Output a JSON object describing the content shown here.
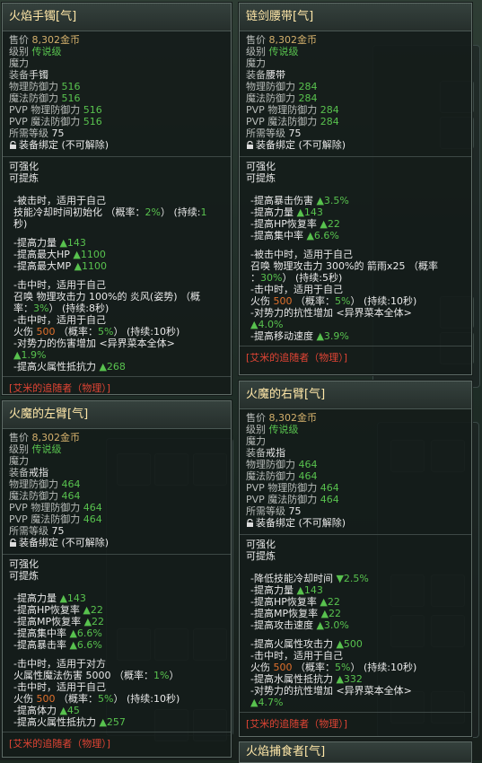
{
  "tooltips": [
    {
      "title": "火焰手镯[气]",
      "price_label": "售价",
      "price": "8,302金币",
      "grade_label": "级别",
      "grade": "传说级",
      "magic": "魔力",
      "equip_label": "装备",
      "equip": "手镯",
      "stats": [
        {
          "label": "物理防御力",
          "value": "516"
        },
        {
          "label": "魔法防御力",
          "value": "516"
        },
        {
          "label": "PVP 物理防御力",
          "value": "516"
        },
        {
          "label": "PVP 魔法防御力",
          "value": "516"
        }
      ],
      "level_label": "所需等级",
      "level": "75",
      "bind": "装备绑定 (不可解除)",
      "enhance1": "可强化",
      "enhance2": "可提炼",
      "lines": [
        {
          "t": "-被击时，适用于自己"
        },
        {
          "t": " 技能冷却时间初始化  （概率：",
          "g": "2%",
          "t2": "） (持续:",
          "g2": "1"
        },
        {
          "t": "秒)"
        },
        {
          "gap": true
        },
        {
          "t": "-提高力量 ",
          "g": "▲143"
        },
        {
          "t": "-提高最大HP ",
          "g": "▲1100"
        },
        {
          "t": "-提高最大MP ",
          "g": "▲1100"
        },
        {
          "gap": true
        },
        {
          "t": "-击中时，适用于自己"
        },
        {
          "t": " 召唤 物理攻击力 100%的 炎风(姿势)  （概"
        },
        {
          "t": "率：",
          "g": "3%",
          "t2": "） (持续:8秒)"
        },
        {
          "t": "-击中时，适用于自己"
        },
        {
          "t": " 火伤 ",
          "o": "500",
          "t2": "  （概率：",
          "g": "5%",
          "t3": "） (持续:10秒)"
        },
        {
          "t": "-对势力的伤害增加  <异界菜本全体>"
        },
        {
          "g": "▲1.9%"
        },
        {
          "t": "-提高火属性抵抗力 ",
          "g": "▲268"
        }
      ],
      "set": "[艾米的追随者（物理）]"
    },
    {
      "title": "链剑腰带[气]",
      "price_label": "售价",
      "price": "8,302金币",
      "grade_label": "级别",
      "grade": "传说级",
      "magic": "魔力",
      "equip_label": "装备",
      "equip": "腰带",
      "stats": [
        {
          "label": "物理防御力",
          "value": "284"
        },
        {
          "label": "魔法防御力",
          "value": "284"
        },
        {
          "label": "PVP 物理防御力",
          "value": "284"
        },
        {
          "label": "PVP 魔法防御力",
          "value": "284"
        }
      ],
      "level_label": "所需等级",
      "level": "75",
      "bind": "装备绑定 (不可解除)",
      "enhance1": "可强化",
      "enhance2": "可提炼",
      "lines": [
        {
          "t": "-提高暴击伤害 ",
          "g": "▲3.5%"
        },
        {
          "t": "-提高力量 ",
          "g": "▲143"
        },
        {
          "t": "-提高HP恢复率 ",
          "g": "▲22"
        },
        {
          "t": "-提高集中率 ",
          "g": "▲6.6%"
        },
        {
          "gap": true
        },
        {
          "t": "-被击中时，适用于自己"
        },
        {
          "t": " 召唤 物理攻击力 300%的 箭雨x25  （概率"
        },
        {
          "t": "：",
          "g": "30%",
          "t2": "） (持续:5秒)"
        },
        {
          "t": "-击中时，适用于自己"
        },
        {
          "t": " 火伤 ",
          "o": "500",
          "t2": "  （概率：",
          "g": "5%",
          "t3": "） (持续:10秒)"
        },
        {
          "t": "-对势力的抗性增加  <异界菜本全体>"
        },
        {
          "g": "▲4.0%"
        },
        {
          "t": "-提高移动速度 ",
          "g": "▲3.9%"
        }
      ],
      "set": "[艾米的追随者（物理）]"
    },
    {
      "title": "火魔的左臂[气]",
      "price_label": "售价",
      "price": "8,302金币",
      "grade_label": "级别",
      "grade": "传说级",
      "magic": "魔力",
      "equip_label": "装备",
      "equip": "戒指",
      "stats": [
        {
          "label": "物理防御力",
          "value": "464"
        },
        {
          "label": "魔法防御力",
          "value": "464"
        },
        {
          "label": "PVP 物理防御力",
          "value": "464"
        },
        {
          "label": "PVP 魔法防御力",
          "value": "464"
        }
      ],
      "level_label": "所需等级",
      "level": "75",
      "bind": "装备绑定 (不可解除)",
      "enhance1": "可强化",
      "enhance2": "可提炼",
      "lines": [
        {
          "t": "-提高力量 ",
          "g": "▲143"
        },
        {
          "t": "-提高HP恢复率 ",
          "g": "▲22"
        },
        {
          "t": "-提高MP恢复率 ",
          "g": "▲22"
        },
        {
          "t": "-提高集中率 ",
          "g": "▲6.6%"
        },
        {
          "t": "-提高暴击率 ",
          "g": "▲6.6%"
        },
        {
          "gap": true
        },
        {
          "t": "-击中时，适用于对方"
        },
        {
          "t": " 火属性魔法伤害 5000  （概率：",
          "g": "1%",
          "t2": "）"
        },
        {
          "t": "-击中时，适用于自己"
        },
        {
          "t": " 火伤 ",
          "o": "500",
          "t2": "  （概率：",
          "g": "5%",
          "t3": "） (持续:10秒)"
        },
        {
          "t": "-提高体力 ",
          "g": "▲45"
        },
        {
          "t": "-提高火属性抵抗力 ",
          "g": "▲257"
        }
      ],
      "set": "[艾米的追随者（物理）]"
    },
    {
      "title": "火魔的右臂[气]",
      "price_label": "售价",
      "price": "8,302金币",
      "grade_label": "级别",
      "grade": "传说级",
      "magic": "魔力",
      "equip_label": "装备",
      "equip": "戒指",
      "stats": [
        {
          "label": "物理防御力",
          "value": "464"
        },
        {
          "label": "魔法防御力",
          "value": "464"
        },
        {
          "label": "PVP 物理防御力",
          "value": "464"
        },
        {
          "label": "PVP 魔法防御力",
          "value": "464"
        }
      ],
      "level_label": "所需等级",
      "level": "75",
      "bind": "装备绑定 (不可解除)",
      "enhance1": "可强化",
      "enhance2": "可提炼",
      "lines": [
        {
          "t": "-降低技能冷却时间 ",
          "g": "▼2.5%"
        },
        {
          "t": "-提高力量 ",
          "g": "▲143"
        },
        {
          "t": "-提高HP恢复率 ",
          "g": "▲22"
        },
        {
          "t": "-提高MP恢复率 ",
          "g": "▲22"
        },
        {
          "t": "-提高攻击速度 ",
          "g": "▲3.0%"
        },
        {
          "gap": true
        },
        {
          "t": "-提高火属性攻击力 ",
          "g": "▲500"
        },
        {
          "t": "-击中时，适用于自己"
        },
        {
          "t": " 火伤 ",
          "o": "500",
          "t2": "  （概率：",
          "g": "5%",
          "t3": "） (持续:10秒)"
        },
        {
          "t": "-提高水属性抵抗力 ",
          "g": "▲332"
        },
        {
          "t": "-对势力的抗性增加  <异界菜本全体>"
        },
        {
          "g": "▲4.7%"
        }
      ],
      "set": "[艾米的追随者（物理）]"
    },
    {
      "title": "火焰捕食者[气]"
    }
  ],
  "colors": {
    "title": "#ffe7a8",
    "value_green": "#58c24e",
    "gold": "#d4b06c",
    "grade_green": "#58c24e",
    "set_red": "#e04434",
    "fire_orange": "#e0702c"
  }
}
